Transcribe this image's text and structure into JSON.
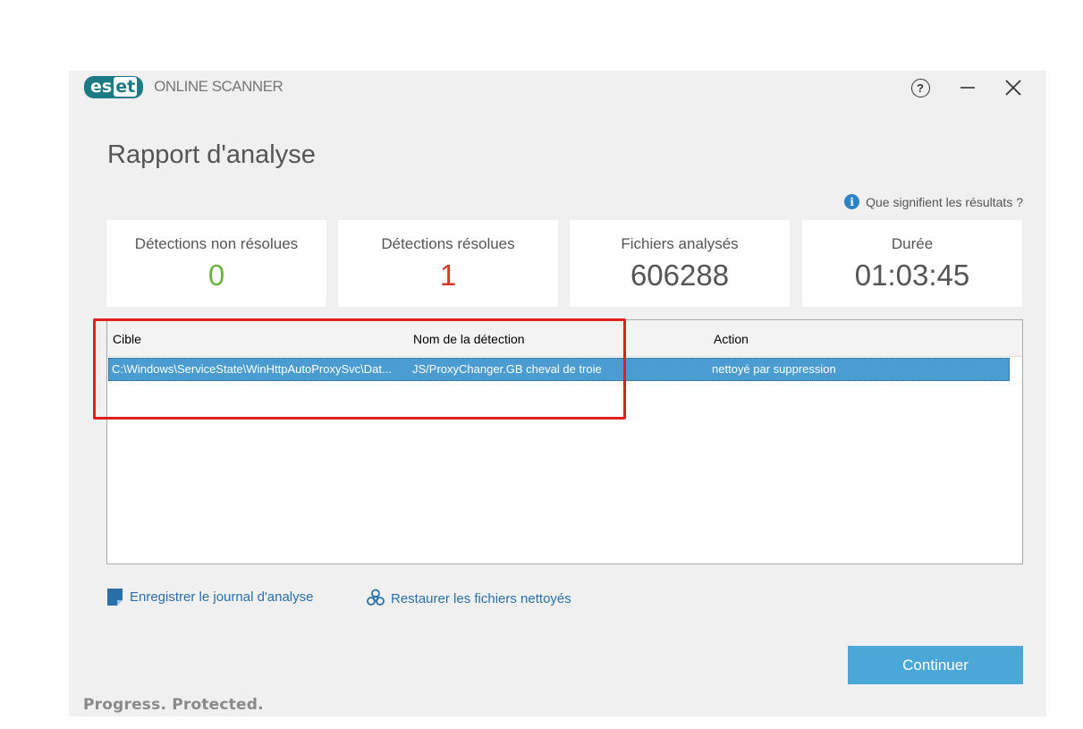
{
  "app": {
    "logo_text_1": "es",
    "logo_text_2": "et",
    "name": "ONLINE SCANNER",
    "help_label": "?",
    "brand_color": "#1c7a85"
  },
  "page_title": "Rapport d'analyse",
  "info_link": "Que signifient les résultats ?",
  "stats": [
    {
      "label": "Détections non résolues",
      "value": "0",
      "color": "#6db33f"
    },
    {
      "label": "Détections résolues",
      "value": "1",
      "color": "#d33a2c"
    },
    {
      "label": "Fichiers analysés",
      "value": "606288"
    },
    {
      "label": "Durée",
      "value": "01:03:45"
    }
  ],
  "table": {
    "columns": [
      "Cible",
      "Nom de la détection",
      "Action"
    ],
    "rows": [
      {
        "target": "C:\\Windows\\ServiceState\\WinHttpAutoProxySvc\\Dat...",
        "detection": "JS/ProxyChanger.GB cheval de troie",
        "action": "nettoyé par suppression"
      }
    ]
  },
  "links": {
    "save_log": "Enregistrer le journal d'analyse",
    "restore_files": "Restaurer les fichiers nettoyés"
  },
  "continue_button": "Continuer",
  "tagline": "Progress. Protected."
}
